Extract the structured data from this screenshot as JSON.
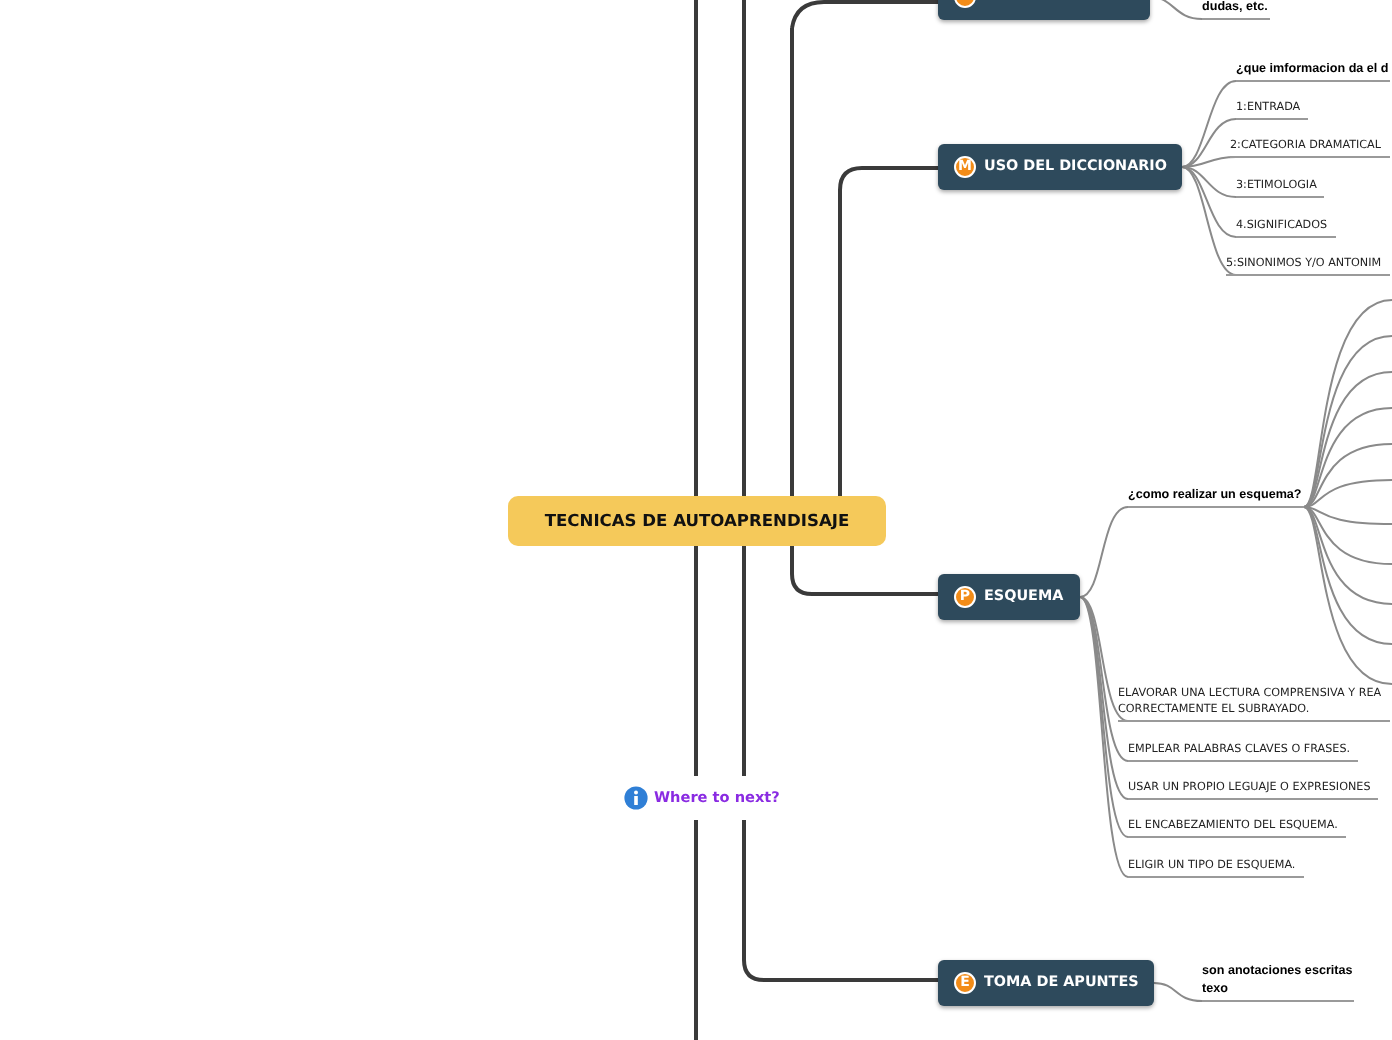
{
  "central_topic": "TECNICAS DE AUTOAPRENDISAJE",
  "branches": [
    {
      "children": [
        {
          "kind": "heading",
          "text": "dudas, etc."
        }
      ]
    },
    {
      "label": "USO DEL DICCIONARIO",
      "badge": "M",
      "children": [
        {
          "kind": "heading",
          "text": "¿que imformacion da el d"
        },
        {
          "kind": "item",
          "text": "1:ENTRADA"
        },
        {
          "kind": "item",
          "text": "2:CATEGORIA DRAMATICAL"
        },
        {
          "kind": "item",
          "text": "3:ETIMOLOGIA"
        },
        {
          "kind": "item",
          "text": "4.SIGNIFICADOS"
        },
        {
          "kind": "item",
          "text": "5:SINONIMOS Y/O ANTONIM"
        }
      ]
    },
    {
      "label": "ESQUEMA",
      "badge": "P",
      "children": [
        {
          "kind": "heading",
          "text": "¿como realizar un esquema?"
        },
        {
          "kind": "item",
          "text": "ELAVORAR UNA LECTURA COMPRENSIVA Y REA\nCORRECTAMENTE EL SUBRAYADO."
        },
        {
          "kind": "item",
          "text": "EMPLEAR PALABRAS CLAVES O FRASES."
        },
        {
          "kind": "item",
          "text": "USAR UN PROPIO LEGUAJE O EXPRESIONES"
        },
        {
          "kind": "item",
          "text": "EL ENCABEZAMIENTO DEL ESQUEMA."
        },
        {
          "kind": "item",
          "text": "ELIGIR UN TIPO DE ESQUEMA."
        }
      ]
    },
    {
      "label": "TOMA DE APUNTES",
      "badge": "E",
      "children": [
        {
          "kind": "heading",
          "text": "son anotaciones escritas\ntexo"
        }
      ]
    }
  ],
  "floating_link": "Where to next?"
}
